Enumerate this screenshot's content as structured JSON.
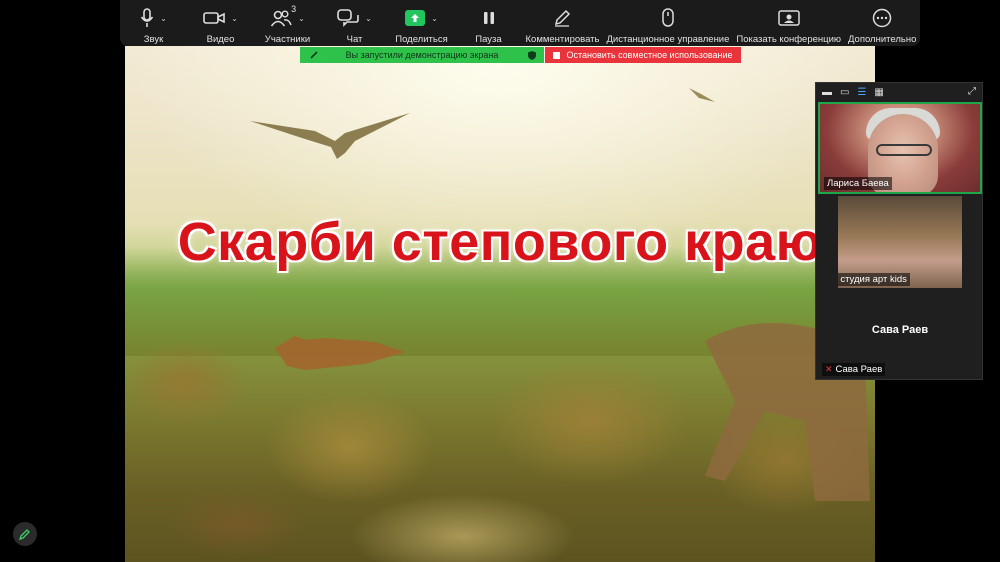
{
  "toolbar": {
    "items": [
      {
        "label": "Звук",
        "icon": "microphone-icon"
      },
      {
        "label": "Видео",
        "icon": "camera-icon"
      },
      {
        "label": "Участники",
        "icon": "participants-icon",
        "count": "3"
      },
      {
        "label": "Чат",
        "icon": "chat-icon"
      },
      {
        "label": "Поделиться",
        "icon": "share-screen-icon"
      },
      {
        "label": "Пауза",
        "icon": "pause-icon"
      },
      {
        "label": "Комментировать",
        "icon": "annotate-pen-icon"
      },
      {
        "label": "Дистанционное управление",
        "icon": "mouse-icon"
      },
      {
        "label": "Показать конференцию",
        "icon": "show-meeting-icon"
      },
      {
        "label": "Дополнительно",
        "icon": "more-icon"
      }
    ]
  },
  "share": {
    "status": "Вы запустили демонстрацию экрана",
    "stop": "Остановить совместное использование"
  },
  "slide": {
    "title": "Скарби степового краю"
  },
  "participants": [
    {
      "name": "Лариса Баева"
    },
    {
      "name": "арт студия арт kids"
    },
    {
      "name": "Сава Раев"
    }
  ],
  "colors": {
    "toolbar_bg": "#1b1b1b",
    "share_green": "#2fc24a",
    "stop_red": "#e8343a",
    "active_speaker": "#1fa54a",
    "title_red": "#d8141a"
  }
}
